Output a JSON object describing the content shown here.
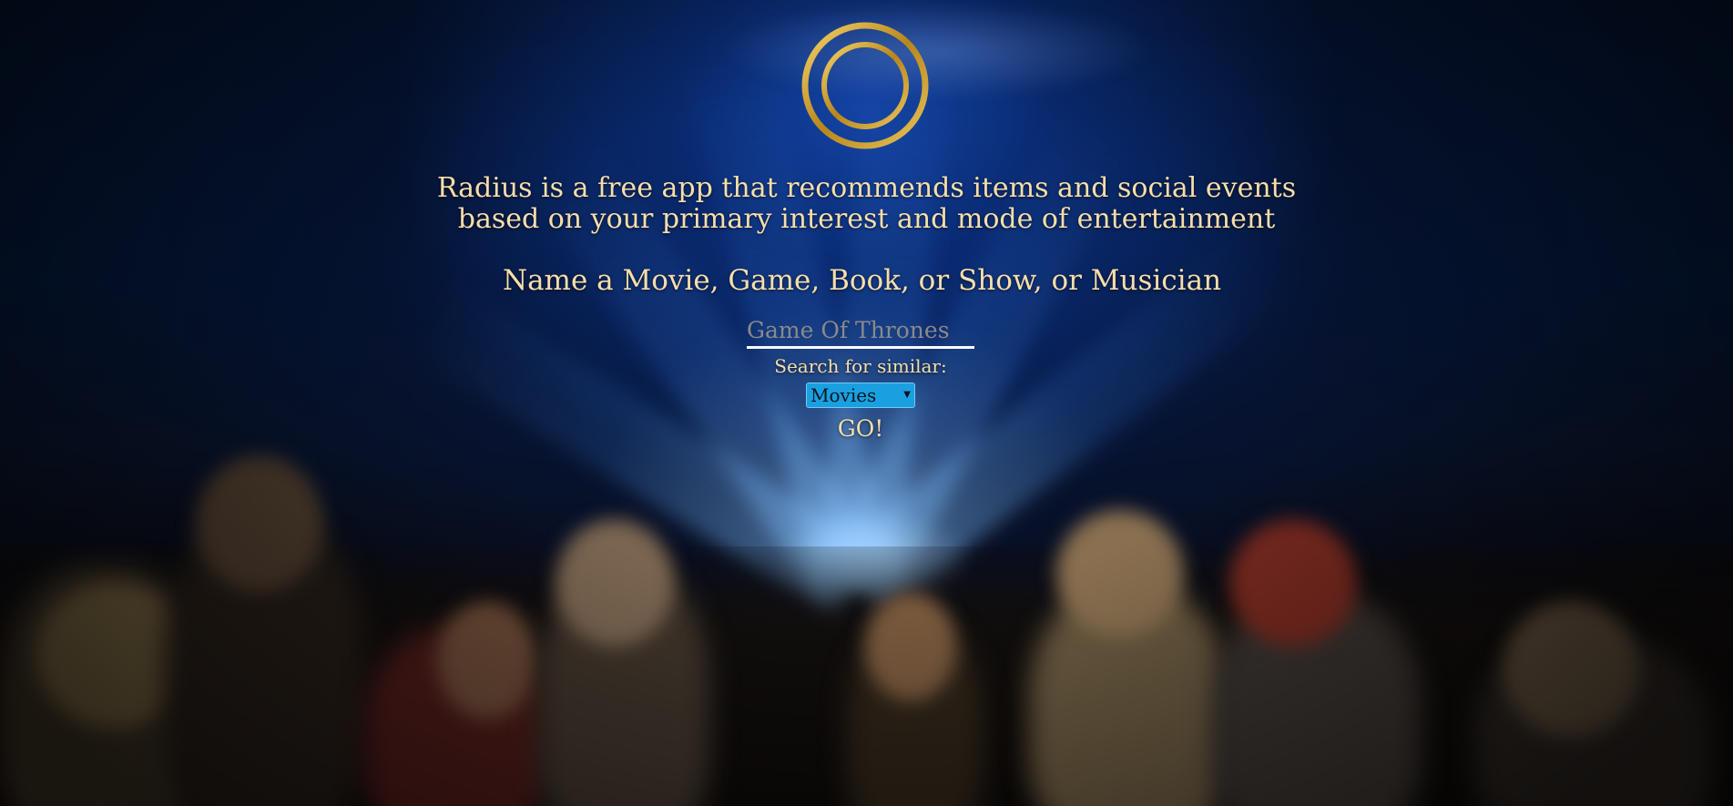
{
  "intro": {
    "tagline_line1": "Radius is a free app that recommends items and social events",
    "tagline_line2": "based on your primary interest and mode of entertainment",
    "prompt": "Name a Movie, Game, Book, or Show, or Musician"
  },
  "search": {
    "placeholder": "Game Of Thrones",
    "value": "",
    "label": "Search for similar:",
    "category_selected": "Movies",
    "submit_label": "GO!"
  },
  "logo": {
    "icon": "concentric-rings-logo",
    "color": "#c9a227"
  },
  "colors": {
    "text": "#f6deab",
    "select_bg": "#1aa0e0",
    "underline": "#ffffff"
  }
}
